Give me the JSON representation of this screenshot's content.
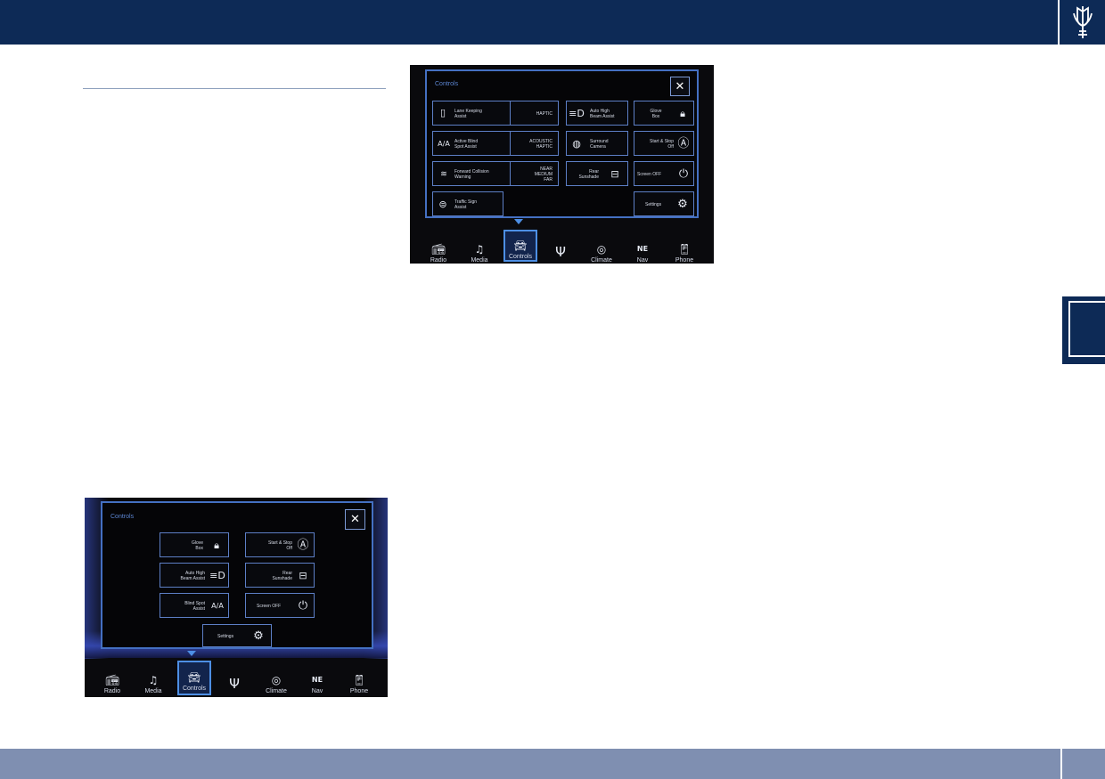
{
  "colors": {
    "header_navy": "#0d2a56",
    "footer_blue": "#7f8fb1",
    "accent_blue": "#4d8fe4"
  },
  "header": {
    "logo_icon": "trident-logo-icon"
  },
  "screen_top": {
    "title": "Controls",
    "close_label": "✕",
    "tiles": {
      "lane_keeping": {
        "label": "Lane Keeping\nAssist",
        "value": "HAPTIC",
        "icon": "lane-keeping-icon"
      },
      "active_blind_spot": {
        "label": "Active Blind\nSpot Assist",
        "value": "ACOUSTIC\nHAPTIC",
        "icon": "blind-spot-icon"
      },
      "forward_collision": {
        "label": "Forward Collision\nWarning",
        "value": "NEAR\nMEDIUM\nFAR",
        "icon": "forward-collision-icon"
      },
      "traffic_sign": {
        "label": "Traffic Sign\nAssist",
        "icon": "speed-sign-icon"
      },
      "auto_high_beam": {
        "label": "Auto High\nBeam Assist",
        "icon": "high-beam-icon"
      },
      "surround_camera": {
        "label": "Surround\nCamera",
        "icon": "camera-icon"
      },
      "rear_sunshade": {
        "label": "Rear\nSunshade",
        "icon": "sunshade-icon"
      },
      "glove_box": {
        "label": "Glove\nBox",
        "icon": "lock-icon"
      },
      "start_stop": {
        "label": "Start & Stop\nOff",
        "icon": "start-stop-icon"
      },
      "screen_off": {
        "label": "Screen OFF",
        "icon": "power-icon"
      },
      "settings": {
        "label": "Settings",
        "icon": "gears-icon"
      }
    }
  },
  "screen_bottom": {
    "title": "Controls",
    "close_label": "✕",
    "tiles": {
      "glove_box": {
        "label": "Glove\nBox",
        "icon": "lock-icon"
      },
      "start_stop": {
        "label": "Start & Stop\nOff",
        "icon": "start-stop-icon"
      },
      "auto_high_beam": {
        "label": "Auto High\nBeam Assist",
        "icon": "high-beam-icon"
      },
      "rear_sunshade": {
        "label": "Rear\nSunshade",
        "icon": "sunshade-icon"
      },
      "blind_spot": {
        "label": "Blind Spot\nAssist",
        "icon": "blind-spot-icon"
      },
      "screen_off": {
        "label": "Screen OFF",
        "icon": "power-icon"
      },
      "settings": {
        "label": "Settings",
        "icon": "gears-icon"
      }
    }
  },
  "nav": {
    "radio": "Radio",
    "media": "Media",
    "controls": "Controls",
    "climate": "Climate",
    "nav": "Nav",
    "phone": "Phone",
    "nav_compass": "NE",
    "active": "Controls"
  }
}
